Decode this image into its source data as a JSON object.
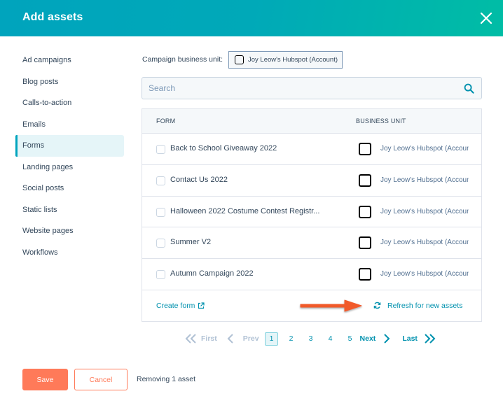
{
  "header": {
    "title": "Add assets",
    "close_icon": "close-icon"
  },
  "sidebar": {
    "items": [
      {
        "label": "Ad campaigns",
        "active": false
      },
      {
        "label": "Blog posts",
        "active": false
      },
      {
        "label": "Calls-to-action",
        "active": false
      },
      {
        "label": "Emails",
        "active": false
      },
      {
        "label": "Forms",
        "active": true
      },
      {
        "label": "Landing pages",
        "active": false
      },
      {
        "label": "Social posts",
        "active": false
      },
      {
        "label": "Static lists",
        "active": false
      },
      {
        "label": "Website pages",
        "active": false
      },
      {
        "label": "Workflows",
        "active": false
      }
    ]
  },
  "business_unit": {
    "label": "Campaign business unit:",
    "value": "Joy Leow's Hubspot (Account)"
  },
  "search": {
    "placeholder": "Search",
    "value": "",
    "icon": "search-icon"
  },
  "table": {
    "columns": [
      "FORM",
      "BUSINESS UNIT"
    ],
    "rows": [
      {
        "name": "Back to School Giveaway 2022",
        "business_unit": "Joy Leow's Hubspot (Account)",
        "checked": false
      },
      {
        "name": "Contact Us 2022",
        "business_unit": "Joy Leow's Hubspot (Account)",
        "checked": false
      },
      {
        "name": "Halloween 2022 Costume Contest Registr...",
        "business_unit": "Joy Leow's Hubspot (Account)",
        "checked": false
      },
      {
        "name": "Summer V2",
        "business_unit": "Joy Leow's Hubspot (Account)",
        "checked": false
      },
      {
        "name": "Autumn Campaign 2022",
        "business_unit": "Joy Leow's Hubspot (Account)",
        "checked": false
      }
    ],
    "create_link": "Create form",
    "refresh_link": "Refresh for new assets"
  },
  "pagination": {
    "first": "First",
    "prev": "Prev",
    "pages": [
      "1",
      "2",
      "3",
      "4",
      "5"
    ],
    "current": "1",
    "next": "Next",
    "last": "Last"
  },
  "footer": {
    "save_label": "Save",
    "cancel_label": "Cancel",
    "status": "Removing 1 asset"
  },
  "colors": {
    "header_start": "#00a4bd",
    "header_end": "#00bda5",
    "accent": "#ff7a59",
    "link": "#0091ae",
    "annotation_arrow": "#f15a2b"
  }
}
